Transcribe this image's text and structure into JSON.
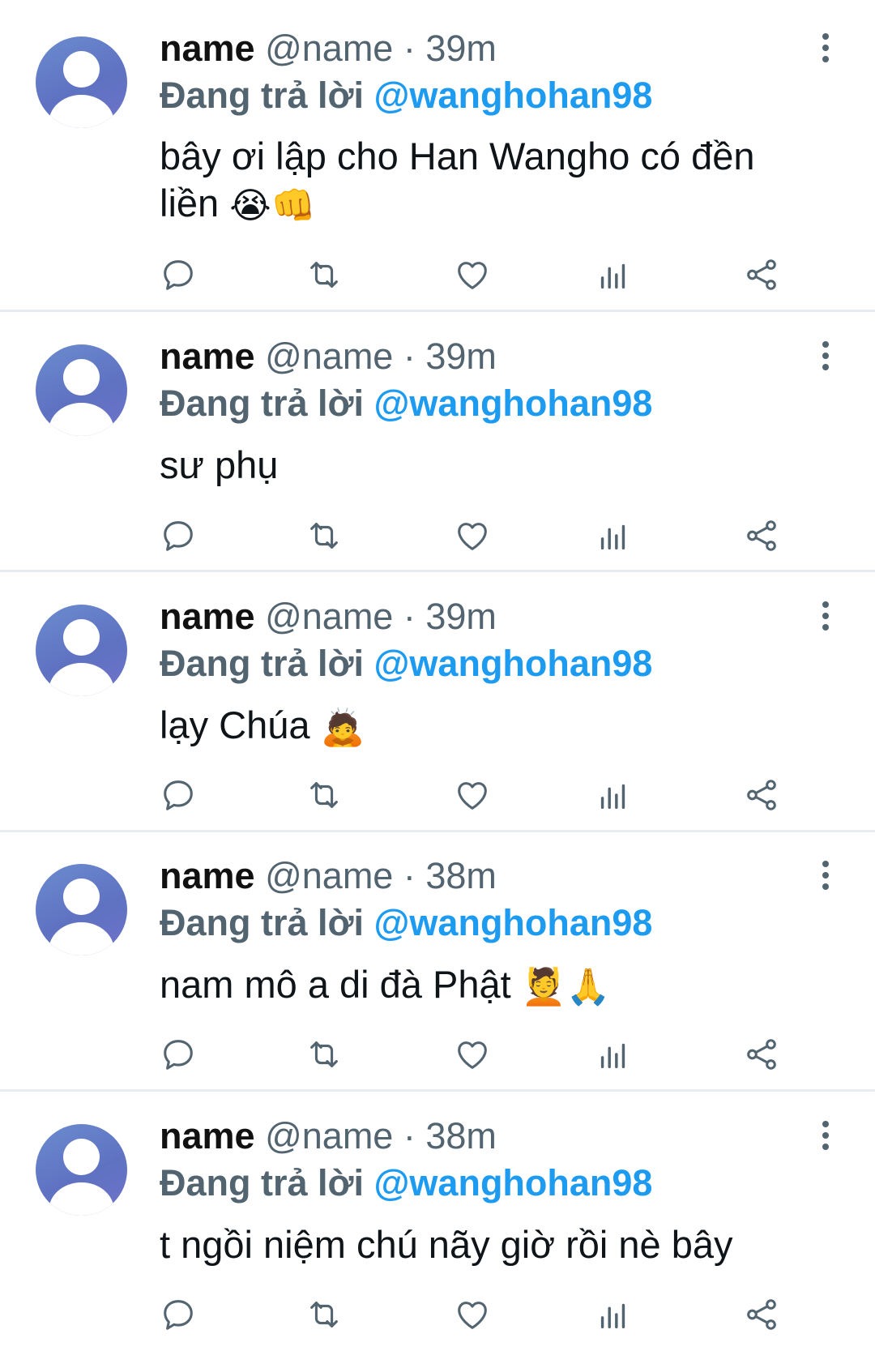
{
  "tweets": [
    {
      "name": "name",
      "handle": "@name",
      "separator": "·",
      "time": "39m",
      "reply_prefix": "Đang trả lời",
      "reply_mention": "@wanghohan98",
      "text": "bây ơi lập cho Han Wangho có đền liền",
      "emojis": "😭👊"
    },
    {
      "name": "name",
      "handle": "@name",
      "separator": "·",
      "time": "39m",
      "reply_prefix": "Đang trả lời",
      "reply_mention": "@wanghohan98",
      "text": "sư phụ",
      "emojis": ""
    },
    {
      "name": "name",
      "handle": "@name",
      "separator": "·",
      "time": "39m",
      "reply_prefix": "Đang trả lời",
      "reply_mention": "@wanghohan98",
      "text": "lạy Chúa",
      "emojis": "🙇"
    },
    {
      "name": "name",
      "handle": "@name",
      "separator": "·",
      "time": "38m",
      "reply_prefix": "Đang trả lời",
      "reply_mention": "@wanghohan98",
      "text": "nam mô a di đà Phật",
      "emojis": "💆🙏"
    },
    {
      "name": "name",
      "handle": "@name",
      "separator": "·",
      "time": "38m",
      "reply_prefix": "Đang trả lời",
      "reply_mention": "@wanghohan98",
      "text": "t ngồi niệm chú nãy giờ rồi nè bây",
      "emojis": ""
    }
  ],
  "icons": {
    "more": "more-vertical-icon",
    "actions": [
      "reply-icon",
      "retweet-icon",
      "like-icon",
      "analytics-icon",
      "share-icon"
    ]
  },
  "colors": {
    "accent": "#1d9bf0",
    "secondary_text": "#536471",
    "divider": "#e6ecf0",
    "avatar": "#6a7fc9"
  }
}
